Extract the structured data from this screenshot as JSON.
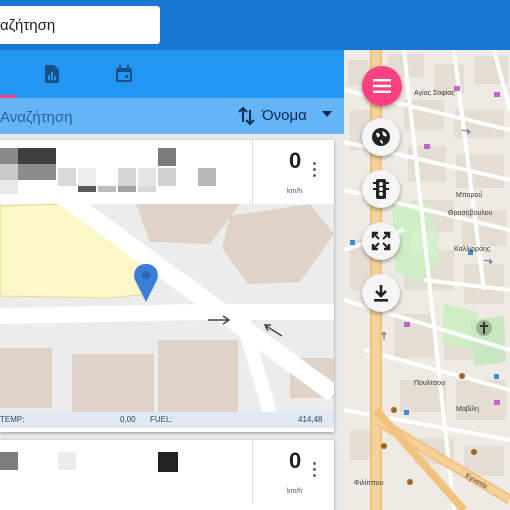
{
  "topbar": {
    "search_value": "αζήτηση"
  },
  "tabs": [
    {
      "icon": "report-icon"
    },
    {
      "icon": "calendar-icon"
    }
  ],
  "filter": {
    "placeholder": "Αναζήτηση",
    "sort_label": "Όνομα"
  },
  "vehicles": [
    {
      "speed": "0",
      "unit": "km/h",
      "footer": {
        "temp_label": "TEMP:",
        "temp_value": "0,00",
        "fuel_label": "FUEL:",
        "fuel_value": "414,48"
      }
    },
    {
      "speed": "0",
      "unit": "km/h"
    }
  ],
  "map": {
    "labels": {
      "l1": "Μπορού",
      "l2": "Θρασύβουλου",
      "l3": "Καλλιρρόης",
      "l4": "Μαβίλη",
      "l5": "Εγνατία",
      "l6": "Αγίας Σοφίας",
      "l7": "Πουλτσου",
      "l8": "Φιλίππου"
    }
  },
  "colors": {
    "accent": "#ff4081",
    "appbar": "#1976d2",
    "tabbar": "#2196f3",
    "filter": "#64b5f6"
  }
}
